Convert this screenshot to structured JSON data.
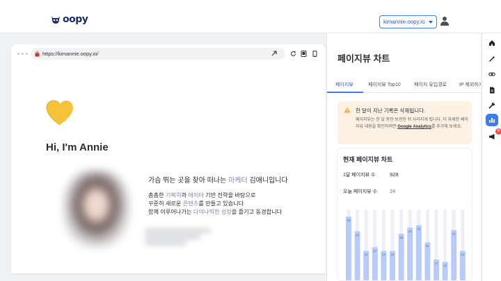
{
  "app": {
    "logo_text": "oopy",
    "site_selector": "kimannie.oopy.io"
  },
  "browser": {
    "url": "https://kimannie.oopy.io/"
  },
  "page": {
    "emoji": "💛",
    "heading": "Hi, I'm Annie",
    "tagline_prefix": "가슴 뛰는 곳을 찾아 떠나는 ",
    "tagline_highlight": "마케터",
    "tagline_suffix": " 김애니입니다",
    "para_line1_a": "촘촘한 ",
    "para_line1_hl1": "기획력",
    "para_line1_b": "과 ",
    "para_line1_hl2": "데이터",
    "para_line1_c": " 기반 전략을 바탕으로",
    "para_line2_a": "꾸준히 새로운 ",
    "para_line2_hl": "콘텐츠",
    "para_line2_b": "를 만들고 있습니다",
    "para_line3_a": "함께 이루어나가는 ",
    "para_line3_hl1": "다이나믹한",
    "para_line3_b": " ",
    "para_line3_hl2": "성장",
    "para_line3_c": "을 즐기고 동경합니다"
  },
  "panel": {
    "title": "페이지뷰 차트",
    "tabs": [
      "페이지뷰",
      "페이지뷰 Top10",
      "페이지 유입경로",
      "IP 제외하기"
    ],
    "notice": {
      "title": "한 달이 지난 기록은 삭제됩니다.",
      "body_a": "페이지뷰는 한 달 동안 보관된 뒤 사라지게 됩니다. 더 자세한 페이지뷰 내용을 확인하려면 ",
      "link": "Google Analytics",
      "body_b": "를 추가해 보세요."
    },
    "card_title": "현재 페이지뷰 차트",
    "stats": [
      {
        "label": "1달 페이지뷰 수",
        "value": "928"
      },
      {
        "label": "오늘 페이지뷰 수",
        "value": "24"
      }
    ]
  },
  "chart_data": {
    "type": "bar",
    "values": [
      52,
      40,
      24,
      27,
      24,
      24,
      38,
      43,
      45,
      31,
      17,
      15,
      41,
      24
    ],
    "labels": [
      "52",
      "40",
      "24",
      "27",
      "24",
      "24",
      "38",
      "43",
      "45",
      "31",
      "17",
      "15",
      "41",
      "24"
    ],
    "color": "#b8cbf9"
  },
  "rail": {
    "icons": [
      "home-icon",
      "magic-wand-icon",
      "link-icon",
      "document-icon",
      "wrench-icon",
      "bar-chart-icon",
      "megaphone-icon"
    ],
    "active_index": 5,
    "badge": "N"
  },
  "colors": {
    "accent": "#3d7bf7",
    "highlight_text": "#8d7bb0",
    "notice_bg": "#fdf1e3"
  }
}
